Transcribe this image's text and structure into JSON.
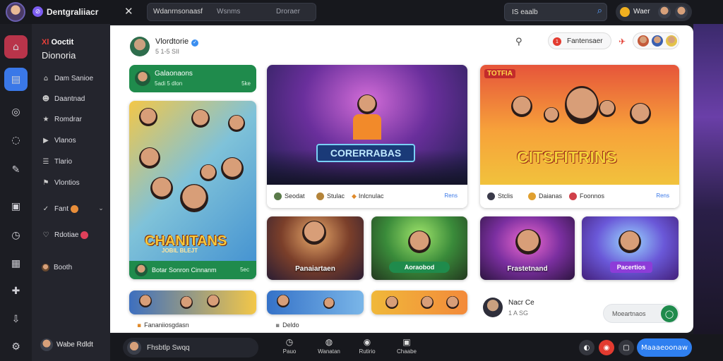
{
  "app": {
    "brand_name": "Dentgraliiacr",
    "logo": "brand-logo-icon"
  },
  "topbar": {
    "search_value": "Wdanrnsonaasf",
    "search_hint": "Wsnms",
    "tab_label": "Droraer",
    "right_search_value": "IS  eaalb",
    "profile_name": "Waer"
  },
  "left_rail": {
    "icons": [
      "home-icon",
      "feed-icon",
      "explore-icon",
      "chat-icon",
      "edit-icon",
      "media-icon",
      "clock-icon",
      "notes-icon",
      "gift-icon",
      "download-icon",
      "settings-icon"
    ]
  },
  "sidebar": {
    "title_red": "Xl",
    "title_rest": "Ooctit",
    "subtitle": "Dionoria",
    "items": [
      {
        "label": "Dam Sanioe",
        "icon": "home-icon"
      },
      {
        "label": "Daantnad",
        "icon": "people-icon"
      },
      {
        "label": "Romdrar",
        "icon": "star-icon"
      },
      {
        "label": "Vlanos",
        "icon": "video-icon"
      },
      {
        "label": "Tlario",
        "icon": "list-icon"
      },
      {
        "label": "Vlontios",
        "icon": "flag-icon"
      },
      {
        "label": "Fant",
        "icon": "check-icon"
      },
      {
        "label": "Rdotiae",
        "icon": "heart-icon"
      },
      {
        "label": "Booth"
      }
    ],
    "footer_user": "Wabe Rdldt"
  },
  "header": {
    "name": "Vlordtorie",
    "meta": "5  1-5  SII",
    "follow_label": "Fantensaer",
    "follow_badge": "1"
  },
  "group_banner": {
    "title": "Galaonaons",
    "sub": "5adi  5 dlon",
    "count": "5ke"
  },
  "cards": {
    "left": {
      "title": "CHANITANS",
      "subtitle": "JOBIL BLEJT",
      "footer": "Botar Sonron Cinnanm",
      "count": "5ec"
    },
    "middle": {
      "title": "CORERRABAS",
      "foot_items": [
        "Seodat",
        "Stulac",
        "Inlcnulac"
      ],
      "link": "Rens"
    },
    "right": {
      "title": "CITSFITRINS",
      "tag": "TOTFIA",
      "foot_items": [
        "Stclis",
        "Daianas",
        "Foonnos"
      ],
      "link": "Rens"
    }
  },
  "mini_cards": [
    "Panaiartaen",
    "Aoraobod",
    "Frastetnand",
    "Pacertios"
  ],
  "bottom_row": {
    "left_label": "Fananiiosgdasn",
    "mid_label": "Deldo"
  },
  "comment": {
    "name": "Nacr Ce",
    "meta": "1 A  SG",
    "placeholder": "Moeartnaos"
  },
  "bottombar": {
    "user_label": "Fhsbtlp Swqq",
    "nav": [
      "Pauo",
      "Wanatan",
      "Rutirio",
      "Chaabe"
    ],
    "cta": "Maaaeoonaw"
  },
  "colors": {
    "accent_green": "#1f8b4c",
    "accent_blue": "#2f7ff0",
    "alert_red": "#e33b30"
  }
}
